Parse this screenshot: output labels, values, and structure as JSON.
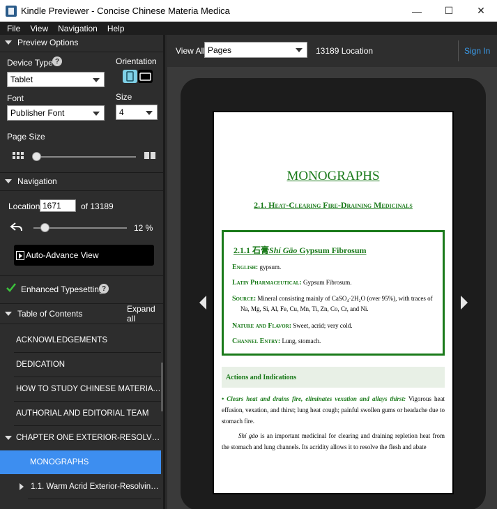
{
  "window": {
    "title": "Kindle Previewer - Concise Chinese Materia Medica",
    "minimize": "—",
    "maximize": "☐",
    "close": "✕"
  },
  "menu": [
    "File",
    "View",
    "Navigation",
    "Help"
  ],
  "preview_options": {
    "header": "Preview Options",
    "device_type_label": "Device Type",
    "device_type_value": "Tablet",
    "orientation_label": "Orientation",
    "font_label": "Font",
    "font_value": "Publisher Font",
    "size_label": "Size",
    "size_value": "4",
    "page_size_label": "Page Size",
    "page_size_level": 0.03
  },
  "navigation": {
    "header": "Navigation",
    "location_label": "Location",
    "location_value": "1671",
    "of_total": "of 13189",
    "progress_percent": "12 %",
    "progress_fraction": 0.12,
    "auto_advance": "Auto-Advance View",
    "enhanced_typesetting": "Enhanced Typesetting"
  },
  "toc": {
    "header": "Table of Contents",
    "expand_all": "Expand all",
    "items": [
      {
        "label": "ACKNOWLEDGEMENTS"
      },
      {
        "label": "DEDICATION"
      },
      {
        "label": "HOW TO STUDY CHINESE MATERIA ME..."
      },
      {
        "label": "AUTHORIAL AND EDITORIAL TEAM"
      },
      {
        "label": "CHAPTER ONE EXTERIOR-RESOLVING M..."
      },
      {
        "label": "MONOGRAPHS"
      },
      {
        "label": "1.1. Warm Acrid Exterior-Resolving ..."
      }
    ]
  },
  "topbar": {
    "view_all": "View All",
    "view_mode": "Pages",
    "location_count": "13189 Location",
    "sign_in": "Sign In"
  },
  "page": {
    "monographs": "MONOGRAPHS",
    "section": "2.1. Heat-Clearing Fire-Draining Medicinals",
    "entry_num": "2.1.1 石膏",
    "entry_pinyin": "Shí Gāo",
    "entry_name": "Gypsum Fibrosum",
    "english_label": "English:",
    "english_value": "gypsum.",
    "latin_label": "Latin Pharmaceutical:",
    "latin_value": "Gypsum Fibrosum.",
    "source_label": "Source:",
    "source_value_1": "Mineral consisting mainly of CaSO₄·2H₂O (over 95%), with traces of",
    "source_value_2": "Na, Mg, Si, Al, Fe, Cu, Mn, Ti, Zn, Co, Cr, and Ni.",
    "nature_label": "Nature and Flavor:",
    "nature_value": "Sweet, acrid; very cold.",
    "channel_label": "Channel Entry:",
    "channel_value": "Lung, stomach.",
    "actions_title": "Actions and Indications",
    "bullet_bold": "• Clears heat and drains fire, eliminates vexation and allays thirst:",
    "bullet_rest": "Vigorous heat effusion, vexation, and thirst; lung heat cough; painful swollen gums or headache due to stomach fire.",
    "para2_italic": "Shí gāo",
    "para2_rest": "is an important medicinal for clearing and draining repletion heat from the stomach and lung channels. Its acridity allows it to resolve the flesh and abate"
  },
  "colors": {
    "accent_blue": "#3d8ef0",
    "green_text": "#1a7a1a",
    "sign_in_blue": "#3a9ae8"
  }
}
